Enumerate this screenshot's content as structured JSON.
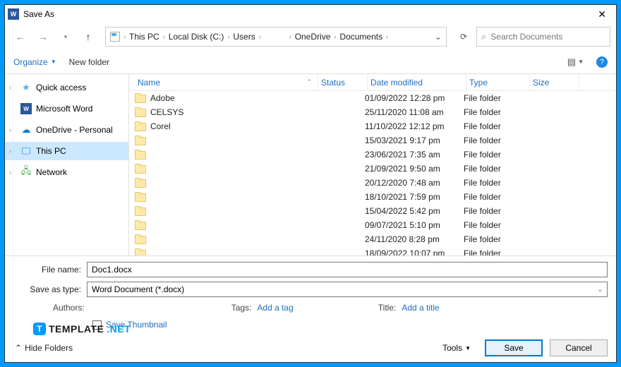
{
  "title": "Save As",
  "breadcrumb": [
    "This PC",
    "Local Disk (C:)",
    "Users",
    "",
    "OneDrive",
    "Documents"
  ],
  "search_placeholder": "Search Documents",
  "toolbar": {
    "organize": "Organize",
    "new_folder": "New folder"
  },
  "sidebar": {
    "items": [
      {
        "label": "Quick access",
        "icon": "qa",
        "expandable": true
      },
      {
        "label": "Microsoft Word",
        "icon": "word",
        "expandable": false
      },
      {
        "label": "OneDrive - Personal",
        "icon": "od",
        "expandable": true
      },
      {
        "label": "This PC",
        "icon": "pc",
        "expandable": true,
        "selected": true
      },
      {
        "label": "Network",
        "icon": "net",
        "expandable": true
      }
    ]
  },
  "columns": {
    "name": "Name",
    "status": "Status",
    "date": "Date modified",
    "type": "Type",
    "size": "Size"
  },
  "rows": [
    {
      "name": "Adobe",
      "date": "01/09/2022 12:28 pm",
      "type": "File folder"
    },
    {
      "name": "CELSYS",
      "date": "25/11/2020 11:08 am",
      "type": "File folder"
    },
    {
      "name": "Corel",
      "date": "11/10/2022 12:12 pm",
      "type": "File folder"
    },
    {
      "name": "",
      "date": "15/03/2021 9:17 pm",
      "type": "File folder"
    },
    {
      "name": "",
      "date": "23/06/2021 7:35 am",
      "type": "File folder"
    },
    {
      "name": "",
      "date": "21/09/2021 9:50 am",
      "type": "File folder"
    },
    {
      "name": "",
      "date": "20/12/2020 7:48 am",
      "type": "File folder"
    },
    {
      "name": "",
      "date": "18/10/2021 7:59 pm",
      "type": "File folder"
    },
    {
      "name": "",
      "date": "15/04/2022 5:42 pm",
      "type": "File folder"
    },
    {
      "name": "",
      "date": "09/07/2021 5:10 pm",
      "type": "File folder"
    },
    {
      "name": "",
      "date": "24/11/2020 8:28 pm",
      "type": "File folder"
    },
    {
      "name": "",
      "date": "18/09/2022 10:07 pm",
      "type": "File folder"
    }
  ],
  "form": {
    "file_name_label": "File name:",
    "file_name_value": "Doc1.docx",
    "save_type_label": "Save as type:",
    "save_type_value": "Word Document (*.docx)",
    "authors_label": "Authors:",
    "tags_label": "Tags:",
    "tags_link": "Add a tag",
    "title_label": "Title:",
    "title_link": "Add a title",
    "thumbnail_label": "Save Thumbnail"
  },
  "footer": {
    "hide_folders": "Hide Folders",
    "tools": "Tools",
    "save": "Save",
    "cancel": "Cancel"
  },
  "watermark": {
    "brand": "TEMPLATE",
    "suffix": ".NET"
  }
}
